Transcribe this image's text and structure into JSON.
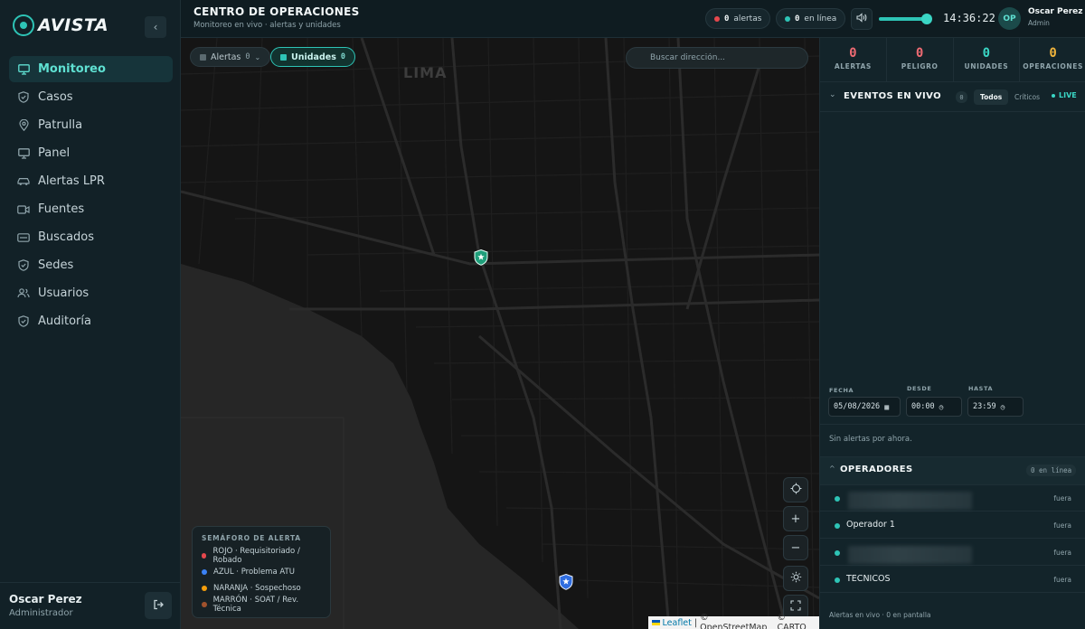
{
  "sidebar": {
    "brand": "AVISTA",
    "items": [
      {
        "label": "Monitoreo",
        "icon": "monitor-icon",
        "active": true
      },
      {
        "label": "Casos",
        "icon": "shield-icon"
      },
      {
        "label": "Patrulla",
        "icon": "pin-icon"
      },
      {
        "label": "Panel",
        "icon": "monitor-icon"
      },
      {
        "label": "Alertas LPR",
        "icon": "car-icon"
      },
      {
        "label": "Fuentes",
        "icon": "camera-icon"
      },
      {
        "label": "Buscados",
        "icon": "id-card-icon"
      },
      {
        "label": "Sedes",
        "icon": "shield-icon"
      },
      {
        "label": "Usuarios",
        "icon": "users-icon"
      },
      {
        "label": "Auditoría",
        "icon": "shield-icon"
      }
    ],
    "user": {
      "name": "Oscar Perez",
      "role": "Administrador"
    }
  },
  "topbar": {
    "title": "CENTRO DE OPERACIONES",
    "subtitle": "Monitoreo en vivo · alertas y unidades",
    "alerts_count": "0",
    "alerts_label": "alertas",
    "online_count": "0",
    "online_label": "en línea",
    "volume": 0.95,
    "clock": "14:36:22",
    "avatar_initials": "OP",
    "user_name": "Oscar Perez",
    "user_role": "Admin"
  },
  "map": {
    "chip_alerts": {
      "label": "Alertas",
      "count": "0"
    },
    "chip_units": {
      "label": "Unidades",
      "count": "0"
    },
    "search_placeholder": "Buscar dirección...",
    "city_label": "LIMA",
    "legend": {
      "title": "SEMÁFORO DE ALERTA",
      "items": [
        {
          "label": "ROJO · Requisitoriado / Robado",
          "color": "#e5484d"
        },
        {
          "label": "AZUL · Problema ATU",
          "color": "#3b82f6"
        },
        {
          "label": "NARANJA · Sospechoso",
          "color": "#f59e0b"
        },
        {
          "label": "MARRÓN · SOAT / Rev. Técnica",
          "color": "#a0522d"
        }
      ]
    },
    "attribution": {
      "leaflet": "Leaflet",
      "osm": "© OpenStreetMap",
      "carto": "© CARTO"
    }
  },
  "stats": [
    {
      "value": "0",
      "label": "ALERTAS",
      "color": "#ef6b73"
    },
    {
      "value": "0",
      "label": "PELIGRO",
      "color": "#ef6b73"
    },
    {
      "value": "0",
      "label": "UNIDADES",
      "color": "#3ad6c5"
    },
    {
      "value": "0",
      "label": "OPERACIONES",
      "color": "#f0b43c"
    }
  ],
  "events": {
    "title": "EVENTOS EN VIVO",
    "count": "0",
    "filter_all": "Todos",
    "filter_critical": "Críticos",
    "live": "LIVE",
    "fecha_label": "FECHA",
    "fecha_value": "05/08/2026",
    "desde_label": "DESDE",
    "desde_value": "00:00",
    "hasta_label": "HASTA",
    "hasta_value": "23:59",
    "empty_text": "Sin alertas por ahora."
  },
  "operators": {
    "title": "OPERADORES",
    "online_badge": "0 en línea",
    "rows": [
      {
        "name": "",
        "status": "fuera",
        "blurred": true
      },
      {
        "name": "Operador 1",
        "status": "fuera",
        "blurred": false
      },
      {
        "name": "",
        "status": "fuera",
        "blurred": true
      },
      {
        "name": "TECNICOS",
        "status": "fuera",
        "blurred": false
      }
    ]
  },
  "footer_text": "Alertas en vivo · 0 en pantalla"
}
